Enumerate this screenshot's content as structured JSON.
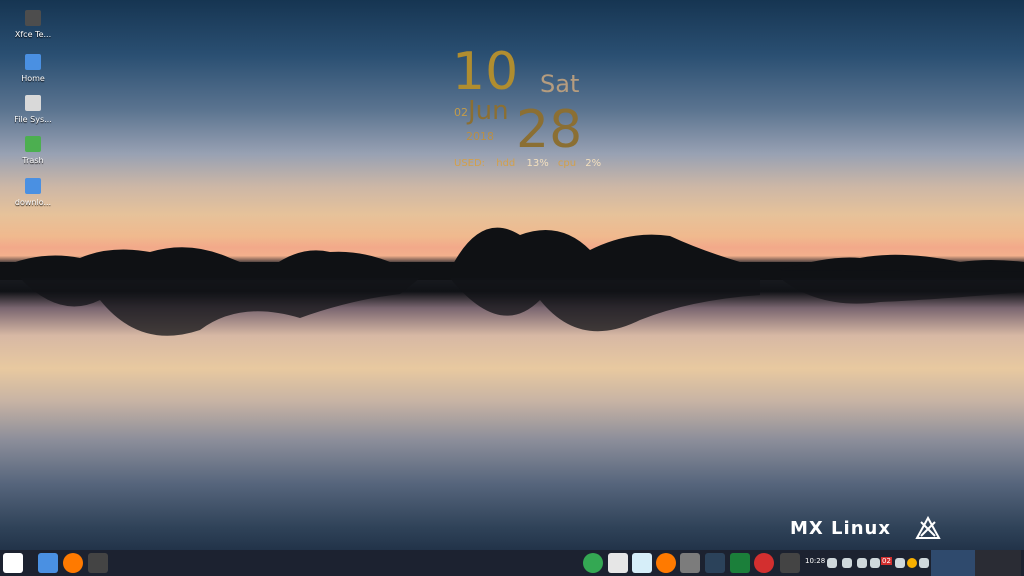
{
  "desktop": {
    "icons": [
      {
        "label": "Xfce Te...",
        "name": "desktop-icon-xfce-terminal",
        "color": "#666666"
      },
      {
        "label": "Home",
        "name": "desktop-icon-home",
        "color": "#4a90e2"
      },
      {
        "label": "File Sys...",
        "name": "desktop-icon-filesystem",
        "color": "#d9d9d9"
      },
      {
        "label": "Trash",
        "name": "desktop-icon-trash",
        "color": "#4caf50"
      },
      {
        "label": "downlo...",
        "name": "desktop-icon-downloads",
        "color": "#4a90e2"
      }
    ]
  },
  "conky": {
    "hour": "10",
    "weekday": "Sat",
    "day": "02",
    "month": "Jun",
    "year": "2018",
    "date": "28",
    "usage_label": "USED:",
    "hdd_label": "hdd",
    "hdd_value": "13%",
    "cpu_label": "cpu",
    "cpu_value": "2%"
  },
  "logo": {
    "text": "MX Linux"
  },
  "taskbar": {
    "clock": "10:28",
    "badge": "02"
  }
}
